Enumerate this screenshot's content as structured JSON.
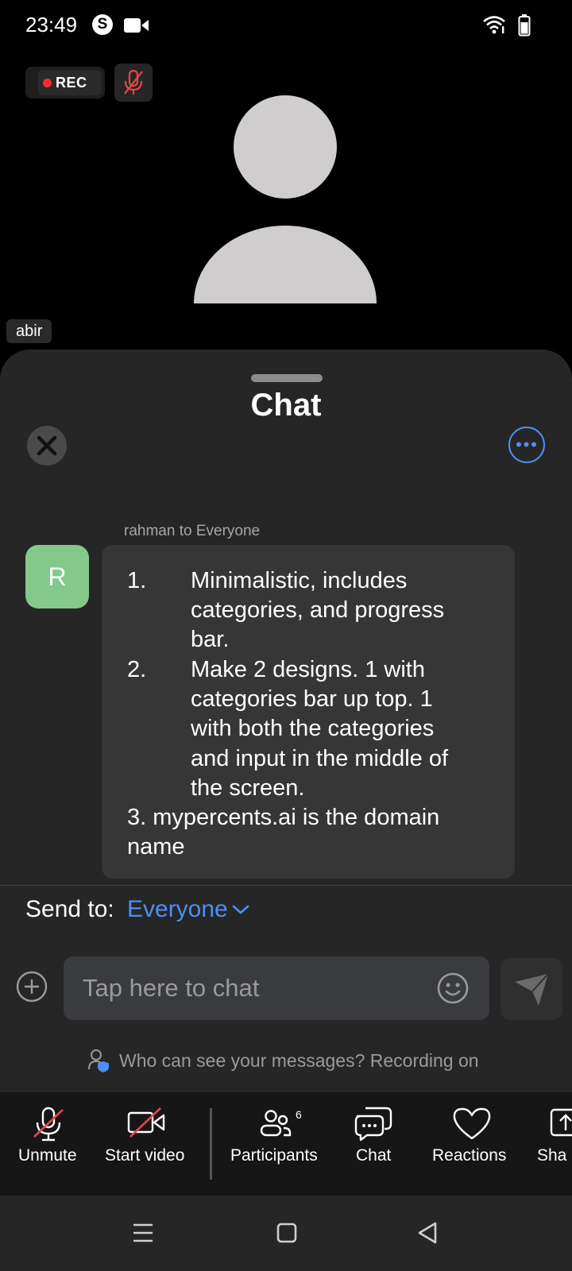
{
  "status_bar": {
    "time": "23:49",
    "icons": [
      "skype-icon",
      "video-camera-icon",
      "wifi-icon",
      "battery-icon"
    ]
  },
  "call": {
    "recording_label": "REC",
    "participant_name": "abir"
  },
  "chat_panel": {
    "title": "Chat",
    "message": {
      "sender_line": "rahman to Everyone",
      "avatar_initial": "R",
      "avatar_color": "#82c98a",
      "lines": [
        {
          "num": "1.",
          "text": "Minimalistic, includes"
        },
        {
          "num": "",
          "text": "categories, and progress"
        },
        {
          "num": "",
          "text": "bar."
        },
        {
          "num": "2.",
          "text": "Make 2 designs. 1 with"
        },
        {
          "num": "",
          "text": "categories bar up top. 1"
        },
        {
          "num": "",
          "text": "with both the categories"
        },
        {
          "num": "",
          "text": "and input in the middle of"
        },
        {
          "num": "",
          "text": "the screen."
        }
      ],
      "line3": "3. mypercents.ai is the domain",
      "line4": "name"
    },
    "send_to": {
      "label": "Send to:",
      "value": "Everyone"
    },
    "input": {
      "placeholder": "Tap here to chat"
    },
    "privacy_notice": "Who can see your messages? Recording on",
    "accent_color": "#4d8ff4"
  },
  "toolbar": {
    "unmute": "Unmute",
    "start_video": "Start video",
    "participants": "Participants",
    "participants_count": "6",
    "chat": "Chat",
    "reactions": "Reactions",
    "share": "Sha"
  }
}
